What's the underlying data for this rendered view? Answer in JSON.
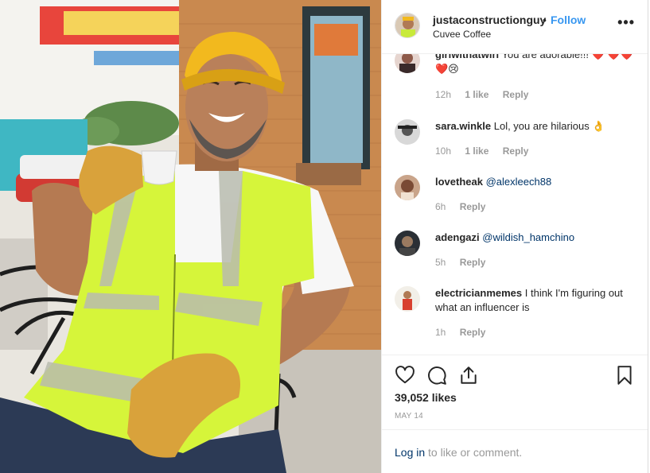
{
  "post": {
    "username": "justaconstructionguy",
    "separator": "•",
    "follow_label": "Follow",
    "location": "Cuvee Coffee",
    "more_icon": "more-options-icon",
    "more_label": "•••"
  },
  "comments": [
    {
      "user": "girlwithatwirl",
      "text": "You are adorable!!! ❤️ ❤️❤️❤️😢",
      "time": "12h",
      "likes": "1 like",
      "reply": "Reply"
    },
    {
      "user": "sara.winkle",
      "text": "Lol, you are hilarious 👌",
      "time": "10h",
      "likes": "1 like",
      "reply": "Reply"
    },
    {
      "user": "lovetheak",
      "mention": "@alexleech88",
      "time": "6h",
      "reply": "Reply"
    },
    {
      "user": "adengazi",
      "mention": "@wildish_hamchino",
      "time": "5h",
      "reply": "Reply"
    },
    {
      "user": "electricianmemes",
      "text": "I think I'm figuring out what an influencer is",
      "time": "1h",
      "reply": "Reply"
    }
  ],
  "actions": {
    "like_icon": "heart-icon",
    "comment_icon": "comment-icon",
    "share_icon": "share-icon",
    "save_icon": "bookmark-icon",
    "likes": "39,052 likes",
    "date": "MAY 14"
  },
  "login": {
    "link": "Log in",
    "rest": " to like or comment."
  },
  "colors": {
    "link_blue": "#3897f0",
    "mention_blue": "#003569",
    "vest": "#d6f53a"
  }
}
